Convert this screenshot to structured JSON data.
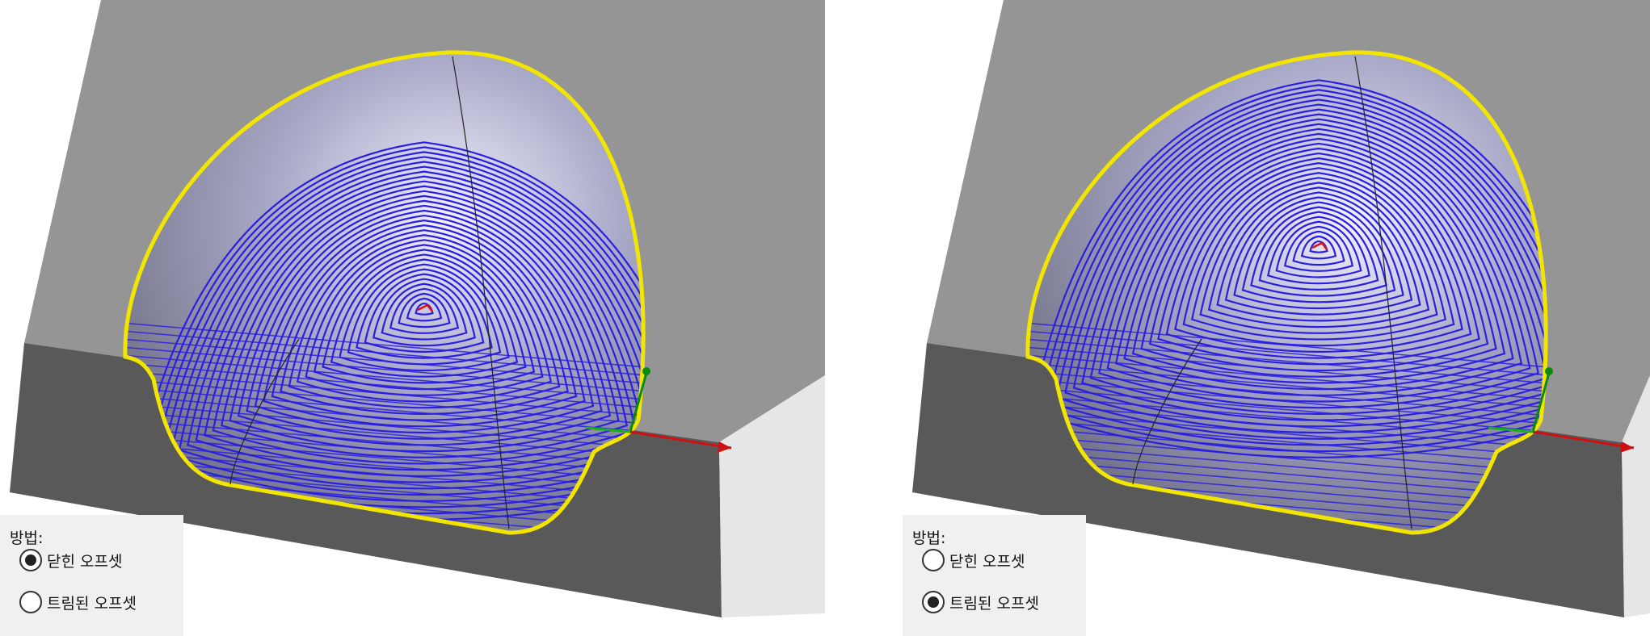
{
  "panels": [
    {
      "method_label": "방법:",
      "options": [
        {
          "label": "닫힌 오프셋",
          "selected": true
        },
        {
          "label": "트림된 오프셋",
          "selected": false
        }
      ],
      "toolpath_style": "closed-offset"
    },
    {
      "method_label": "방법:",
      "options": [
        {
          "label": "닫힌 오프셋",
          "selected": false
        },
        {
          "label": "트림된 오프셋",
          "selected": true
        }
      ],
      "toolpath_style": "trimmed-offset"
    }
  ],
  "colors": {
    "block_top": "#959595",
    "block_front": "#595959",
    "block_side": "#e6e6e6",
    "toolpath": "#2b1fe0",
    "boundary": "#f2e600",
    "axis_x": "#d01010",
    "axis_y": "#18b018",
    "axis_z": "#0a8a0a"
  }
}
